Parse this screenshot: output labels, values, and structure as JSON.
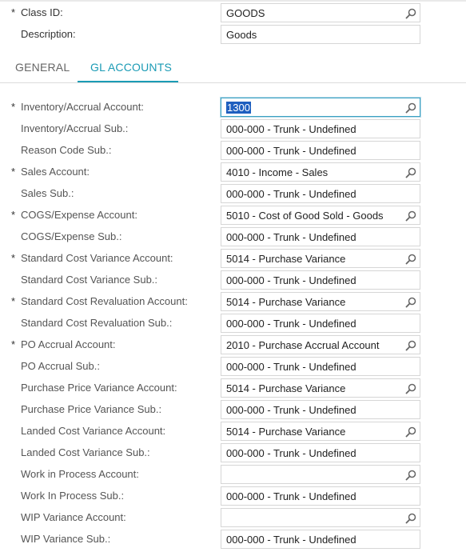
{
  "header": {
    "class_id": {
      "label": "Class ID:",
      "value": "GOODS",
      "required": true
    },
    "description": {
      "label": "Description:",
      "value": "Goods"
    }
  },
  "tabs": [
    {
      "label": "GENERAL",
      "active": false
    },
    {
      "label": "GL ACCOUNTS",
      "active": true
    }
  ],
  "fields": [
    {
      "label": "Inventory/Accrual Account:",
      "value": "1300",
      "required": true,
      "lookup": true
    },
    {
      "label": "Inventory/Accrual Sub.:",
      "value": "000-000 - Trunk - Undefined",
      "required": false,
      "lookup": false
    },
    {
      "label": "Reason Code Sub.:",
      "value": "000-000 - Trunk - Undefined",
      "required": false,
      "lookup": false
    },
    {
      "label": "Sales Account:",
      "value": "4010 - Income - Sales",
      "required": true,
      "lookup": true
    },
    {
      "label": "Sales Sub.:",
      "value": "000-000 - Trunk - Undefined",
      "required": false,
      "lookup": false
    },
    {
      "label": "COGS/Expense Account:",
      "value": "5010 - Cost of Good Sold - Goods",
      "required": true,
      "lookup": true
    },
    {
      "label": "COGS/Expense Sub.:",
      "value": "000-000 - Trunk - Undefined",
      "required": false,
      "lookup": false
    },
    {
      "label": "Standard Cost Variance Account:",
      "value": "5014 - Purchase Variance",
      "required": true,
      "lookup": true
    },
    {
      "label": "Standard Cost Variance Sub.:",
      "value": "000-000 - Trunk - Undefined",
      "required": false,
      "lookup": false
    },
    {
      "label": "Standard Cost Revaluation Account:",
      "value": "5014 - Purchase Variance",
      "required": true,
      "lookup": true
    },
    {
      "label": "Standard Cost Revaluation Sub.:",
      "value": "000-000 - Trunk - Undefined",
      "required": false,
      "lookup": false
    },
    {
      "label": "PO Accrual Account:",
      "value": "2010 - Purchase Accrual Account",
      "required": true,
      "lookup": true
    },
    {
      "label": "PO Accrual Sub.:",
      "value": "000-000 - Trunk - Undefined",
      "required": false,
      "lookup": false
    },
    {
      "label": "Purchase Price Variance Account:",
      "value": "5014 - Purchase Variance",
      "required": false,
      "lookup": true
    },
    {
      "label": "Purchase Price Variance Sub.:",
      "value": "000-000 - Trunk - Undefined",
      "required": false,
      "lookup": false
    },
    {
      "label": "Landed Cost Variance Account:",
      "value": "5014 - Purchase Variance",
      "required": false,
      "lookup": true
    },
    {
      "label": "Landed Cost Variance Sub.:",
      "value": "000-000 - Trunk - Undefined",
      "required": false,
      "lookup": false
    },
    {
      "label": "Work in Process Account:",
      "value": "",
      "required": false,
      "lookup": true
    },
    {
      "label": "Work In Process Sub.:",
      "value": "000-000 - Trunk - Undefined",
      "required": false,
      "lookup": false
    },
    {
      "label": "WIP Variance Account:",
      "value": "",
      "required": false,
      "lookup": true
    },
    {
      "label": "WIP Variance Sub.:",
      "value": "000-000 - Trunk - Undefined",
      "required": false,
      "lookup": false
    }
  ],
  "icons": {
    "lookup": "search-icon",
    "required_marker": "*"
  },
  "colors": {
    "accent": "#1b9bb5",
    "selection": "#1e5fbf",
    "border": "#d6d6d6"
  }
}
